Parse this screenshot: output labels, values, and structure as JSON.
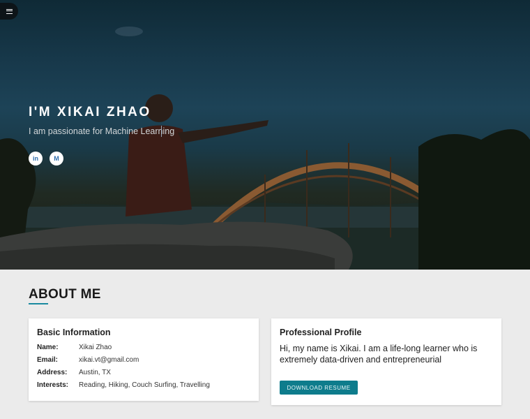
{
  "hero": {
    "title": "I'M XIKAI ZHAO",
    "tagline": "I am passionate for Machine Learning",
    "social": [
      {
        "name": "linkedin",
        "glyph": "in"
      },
      {
        "name": "medium",
        "glyph": "M"
      }
    ]
  },
  "menu": {
    "icon": "hamburger-icon"
  },
  "about": {
    "heading": "ABOUT ME",
    "basic": {
      "title": "Basic Information",
      "rows": [
        {
          "key": "Name:",
          "value": "Xikai Zhao"
        },
        {
          "key": "Email:",
          "value": "xikai.vt@gmail.com"
        },
        {
          "key": "Address:",
          "value": "Austin, TX"
        },
        {
          "key": "Interests:",
          "value": "Reading, Hiking, Couch Surfing, Travelling"
        }
      ]
    },
    "profile": {
      "title": "Professional Profile",
      "text": "Hi, my name is Xikai. I am a life-long learner who is extremely data-driven and entrepreneurial",
      "button": "DOWNLOAD RESUME"
    }
  },
  "colors": {
    "accent": "#0e7c8c",
    "hero_sky": "#17384a"
  }
}
